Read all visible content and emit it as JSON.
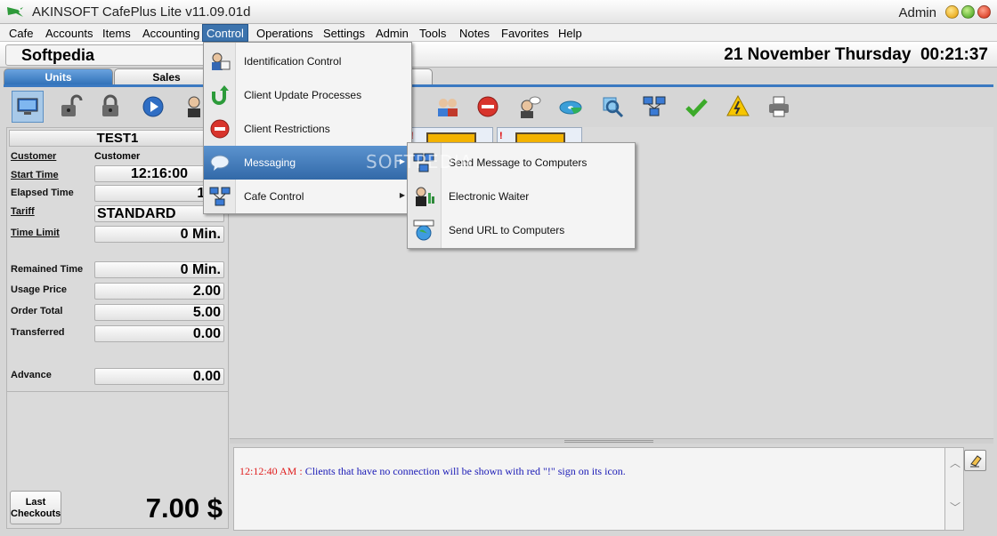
{
  "window": {
    "title": "AKINSOFT CafePlus Lite v11.09.01d",
    "user": "Admin"
  },
  "menu": [
    "Cafe",
    "Accounts",
    "Items",
    "Accounting",
    "Control",
    "Operations",
    "Settings",
    "Admin",
    "Tools",
    "Notes",
    "Favorites",
    "Help"
  ],
  "menu_active": "Control",
  "header": {
    "cafe_name": "Softpedia",
    "datetime": "21 November Thursday  00:21:37"
  },
  "tabs": [
    "Units",
    "Sales",
    "t"
  ],
  "toolbar_icons": [
    "monitor-icon",
    "unlock-icon",
    "lock-icon",
    "play-icon",
    "person-icon",
    "users-icon",
    "stop-icon",
    "person-chat-icon",
    "disc-icon",
    "search-icon",
    "network-icon",
    "check-icon",
    "power-icon",
    "printer-icon"
  ],
  "unit": {
    "name": "TEST1",
    "customer_label": "Customer",
    "customer_value": "Customer",
    "start_time_label": "Start Time",
    "start_time": "12:16:00",
    "elapsed_label": "Elapsed Time",
    "elapsed": "1 M",
    "tariff_label": "Tariff",
    "tariff": "STANDARD",
    "time_limit_label": "Time Limit",
    "time_limit": "0 Min.",
    "remained_label": "Remained Time",
    "remained": "0 Min.",
    "usage_price_label": "Usage Price",
    "usage_price": "2.00",
    "order_total_label": "Order Total",
    "order_total": "5.00",
    "transferred_label": "Transferred",
    "transferred": "0.00",
    "advance_label": "Advance",
    "advance": "0.00"
  },
  "footer": {
    "last_checkouts": "Last\nCheckouts",
    "total": "7.00 $"
  },
  "tile_marks": [
    "!",
    "!"
  ],
  "log": {
    "time": "12:12:40 AM :",
    "message": "Clients that have no connection will be shown with red \"!\" sign on its icon."
  },
  "control_menu": [
    {
      "label": "Identification Control",
      "icon": "id-card-icon",
      "submenu": false
    },
    {
      "label": "Client Update Processes",
      "icon": "update-arrow-icon",
      "submenu": false
    },
    {
      "label": "Client Restrictions",
      "icon": "stop-icon",
      "submenu": false
    },
    {
      "label": "Messaging",
      "icon": "speech-bubble-icon",
      "submenu": true
    },
    {
      "label": "Cafe Control",
      "icon": "network-icon",
      "submenu": true
    }
  ],
  "messaging_submenu": [
    {
      "label": "Send Message to Computers",
      "icon": "computers-icon"
    },
    {
      "label": "Electronic Waiter",
      "icon": "waiter-icon"
    },
    {
      "label": "Send URL to Computers",
      "icon": "globe-icon"
    }
  ],
  "watermark": "SOFTPEDIA",
  "colors": {
    "accent": "#3b79c1",
    "menu_highlight": "#3c73ad",
    "log_time": "#e02020",
    "log_msg": "#1a1ab6"
  }
}
